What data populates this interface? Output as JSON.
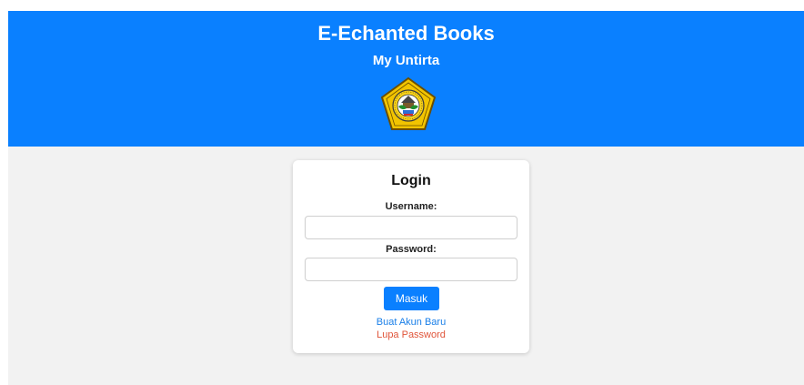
{
  "header": {
    "title": "E-Echanted Books",
    "subtitle": "My Untirta",
    "logo_icon": "university-seal-icon"
  },
  "login": {
    "title": "Login",
    "username_label": "Username:",
    "username_value": "",
    "password_label": "Password:",
    "password_value": "",
    "submit_label": "Masuk",
    "register_link": "Buat Akun Baru",
    "forgot_link": "Lupa Password"
  },
  "colors": {
    "header_bg": "#0a80ff",
    "page_bg": "#f2f2f2",
    "button_bg": "#0a80ff",
    "register_link": "#1a7fe8",
    "forgot_link": "#e0553a"
  }
}
